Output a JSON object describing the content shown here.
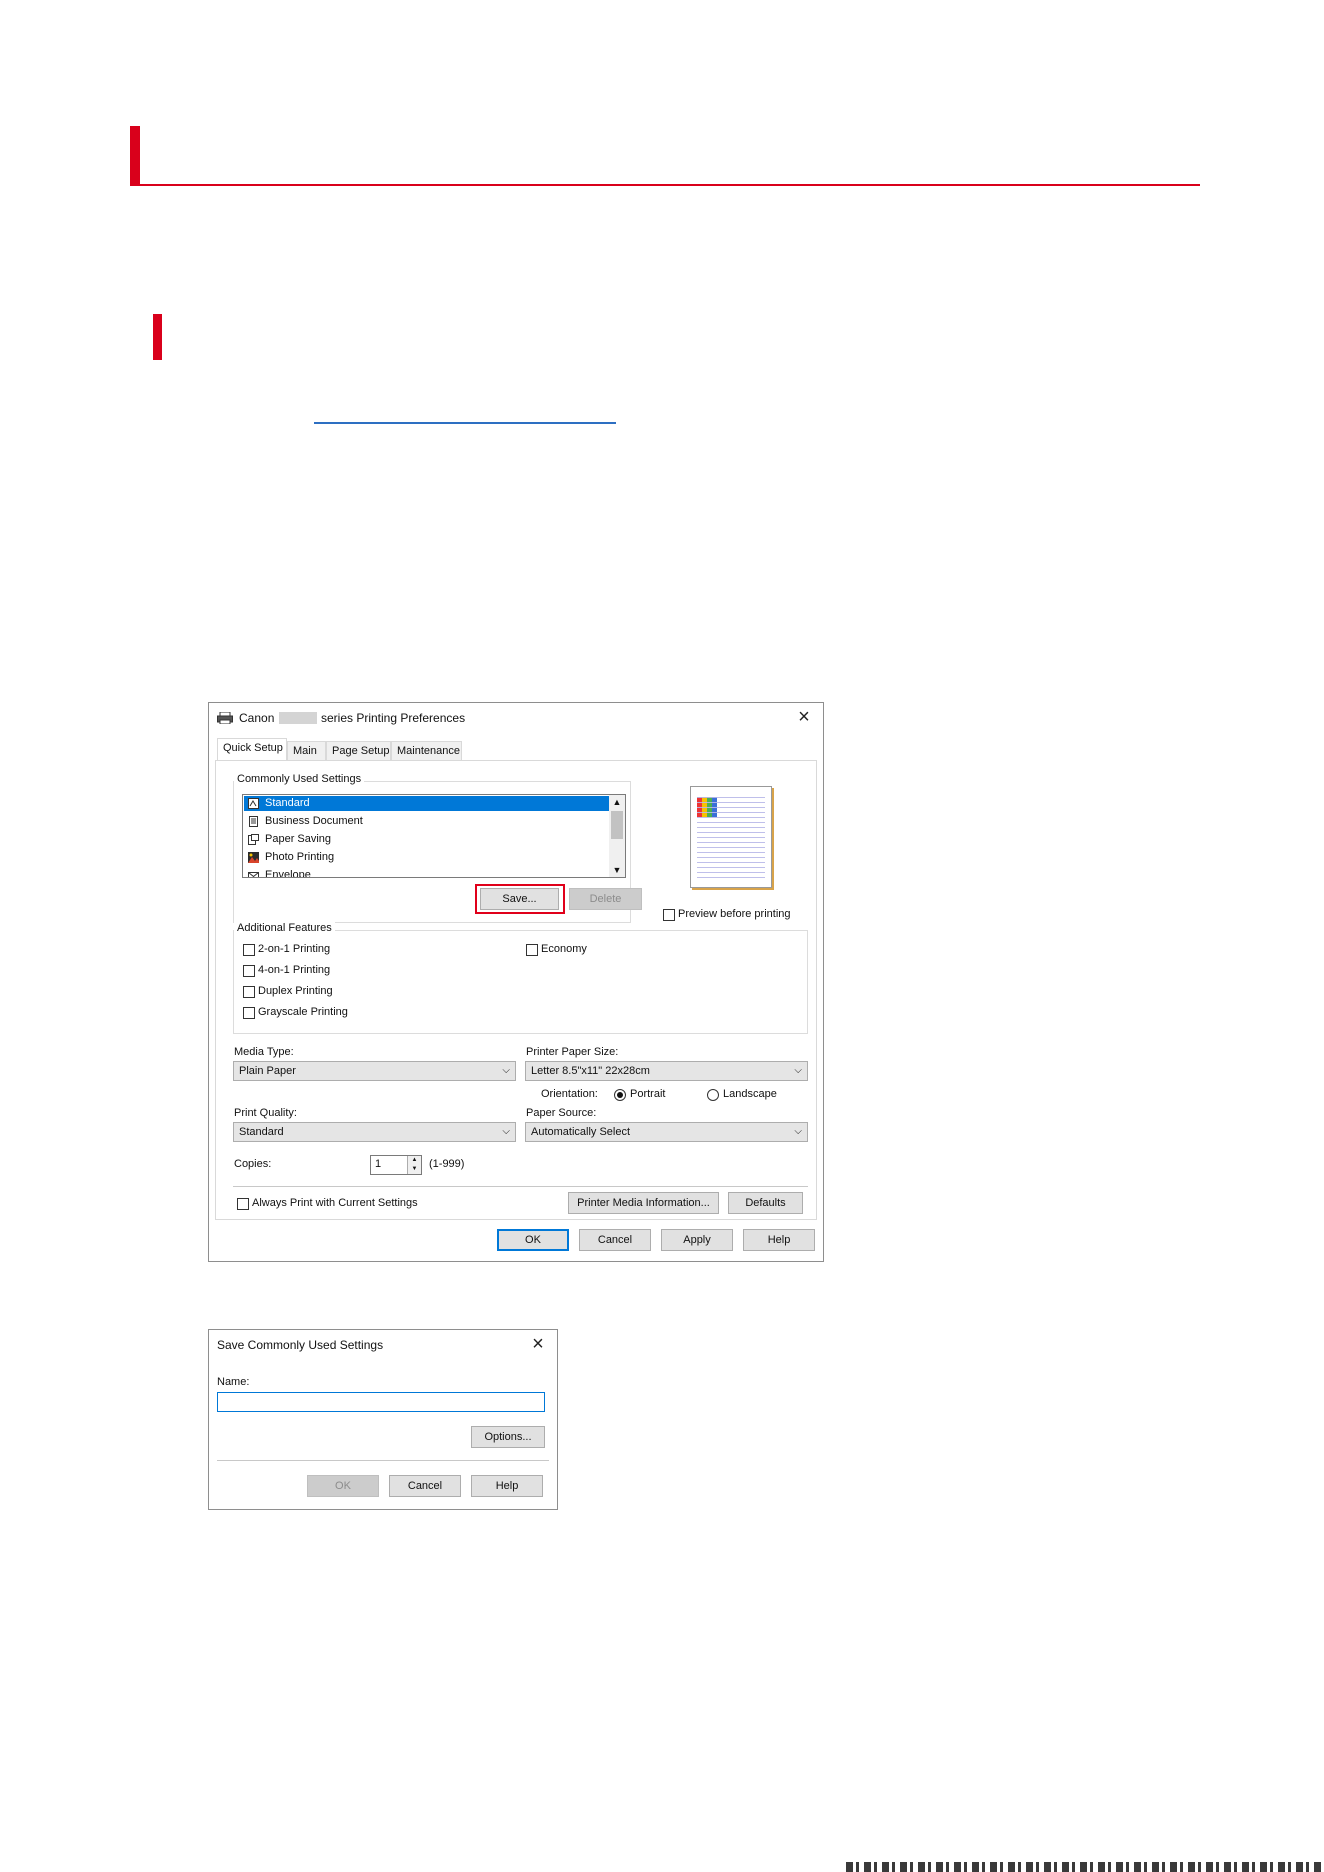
{
  "main_dialog": {
    "title_pre": "Canon",
    "title_post": "series Printing Preferences",
    "tabs": [
      {
        "label": "Quick Setup"
      },
      {
        "label": "Main"
      },
      {
        "label": "Page Setup"
      },
      {
        "label": "Maintenance"
      }
    ],
    "commonly_used_label": "Commonly Used Settings",
    "settings_list": [
      {
        "label": "Standard",
        "selected": true
      },
      {
        "label": "Business Document"
      },
      {
        "label": "Paper Saving"
      },
      {
        "label": "Photo Printing"
      },
      {
        "label": "Envelope"
      }
    ],
    "save_button": "Save...",
    "delete_button": "Delete",
    "preview_label": "Preview before printing",
    "additional_features_label": "Additional Features",
    "features_left": [
      {
        "label": "2-on-1 Printing"
      },
      {
        "label": "4-on-1 Printing"
      },
      {
        "label": "Duplex Printing"
      },
      {
        "label": "Grayscale Printing"
      }
    ],
    "features_right": [
      {
        "label": "Economy"
      }
    ],
    "media_type_label": "Media Type:",
    "media_type_value": "Plain Paper",
    "paper_size_label": "Printer Paper Size:",
    "paper_size_value": "Letter 8.5\"x11\" 22x28cm",
    "orientation_label": "Orientation:",
    "orientation_portrait": "Portrait",
    "orientation_landscape": "Landscape",
    "print_quality_label": "Print Quality:",
    "print_quality_value": "Standard",
    "paper_source_label": "Paper Source:",
    "paper_source_value": "Automatically Select",
    "copies_label": "Copies:",
    "copies_value": "1",
    "copies_range": "(1-999)",
    "always_print_label": "Always Print with Current Settings",
    "printer_media_button": "Printer Media Information...",
    "defaults_button": "Defaults",
    "ok_button": "OK",
    "cancel_button": "Cancel",
    "apply_button": "Apply",
    "help_button": "Help"
  },
  "save_dialog": {
    "title": "Save Commonly Used Settings",
    "name_label": "Name:",
    "name_value": "",
    "options_button": "Options...",
    "ok_button": "OK",
    "cancel_button": "Cancel",
    "help_button": "Help"
  },
  "colors": {
    "heading_accent": "#d9001b",
    "link": "#2d6fc2",
    "selection": "#0078d7",
    "highlight_box": "#e0001a"
  }
}
